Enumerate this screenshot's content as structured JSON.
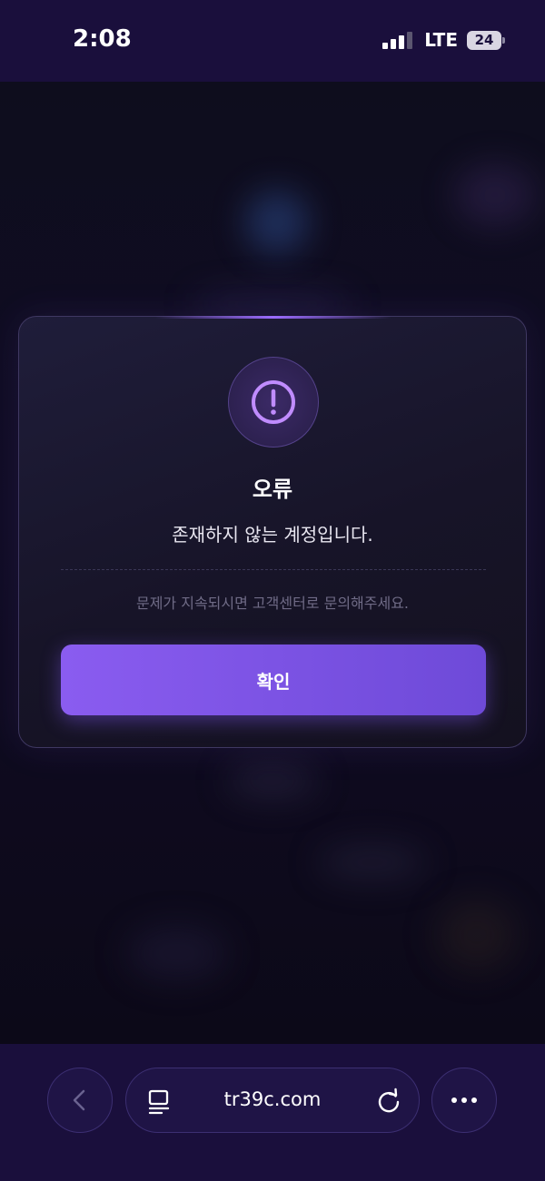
{
  "status_bar": {
    "time": "2:08",
    "network": "LTE",
    "battery": "24"
  },
  "dialog": {
    "icon": "exclamation-circle-icon",
    "title": "오류",
    "message": "존재하지 않는 계정입니다.",
    "hint": "문제가 지속되시면 고객센터로 문의해주세요.",
    "confirm_label": "확인",
    "accent_color": "#8a5cf0"
  },
  "browser_bar": {
    "url": "tr39c.com",
    "back_icon": "chevron-left-icon",
    "reader_icon": "reader-mode-icon",
    "reload_icon": "reload-icon",
    "more_icon": "more-dots-icon"
  }
}
